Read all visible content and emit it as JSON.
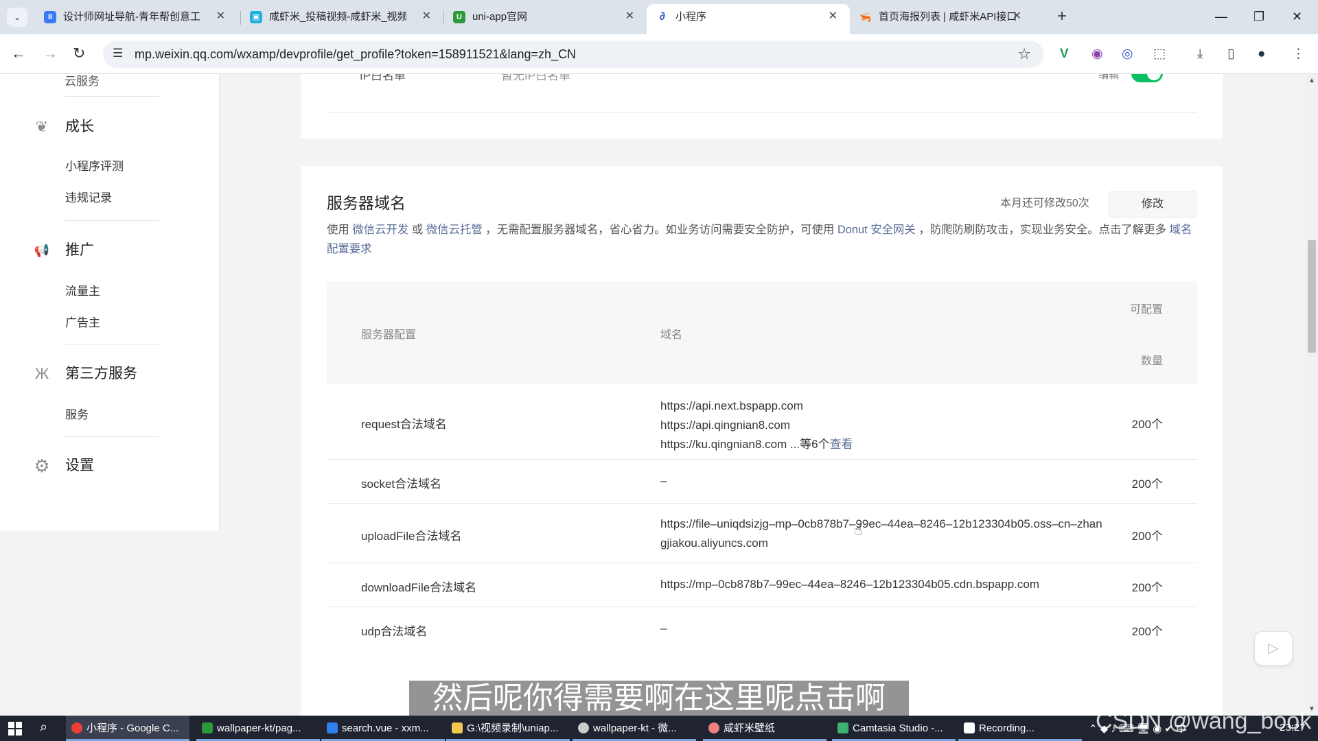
{
  "browser": {
    "tabs": [
      {
        "title": "设计师网址导航-青年帮创意工作",
        "fav_color": "#3b7bf6",
        "fav_glyph": "8"
      },
      {
        "title": "咸虾米_投稿视频-咸虾米_视频分享",
        "fav_color": "#23ade5",
        "fav_glyph": "▣"
      },
      {
        "title": "uni-app官网",
        "fav_color": "#2b9939",
        "fav_glyph": "U"
      },
      {
        "title": "小程序",
        "fav_color": "#ffffff",
        "fav_glyph": "∂"
      },
      {
        "title": "首页海报列表 | 咸虾米API接口开放",
        "fav_color": "#ffffff",
        "fav_glyph": "🦐"
      }
    ],
    "new_tab": "+",
    "url": "mp.weixin.qq.com/wxamp/devprofile/get_profile?token=158911521&lang=zh_CN"
  },
  "sidebar": {
    "cut_item": "云服务",
    "groups": [
      {
        "label": "成长",
        "icon": "leaf-icon",
        "glyph": "❦",
        "items": [
          "小程序评测",
          "违规记录"
        ]
      },
      {
        "label": "推广",
        "icon": "megaphone-icon",
        "glyph": "📢",
        "items": [
          "流量主",
          "广告主"
        ]
      },
      {
        "label": "第三方服务",
        "icon": "third-party-icon",
        "glyph": "Ж",
        "items": [
          "服务"
        ]
      },
      {
        "label": "设置",
        "icon": "gear-icon",
        "glyph": "⚙",
        "items": []
      }
    ]
  },
  "top_card": {
    "cut_label": "IP白名单",
    "cut_value": "暂无IP白名单",
    "cut_action": "编辑"
  },
  "server_domain": {
    "title": "服务器域名",
    "quota": "本月还可修改50次",
    "modify_button": "修改",
    "desc_1": "使用 ",
    "link_cloud_dev": "微信云开发",
    "desc_2": " 或 ",
    "link_cloud_host": "微信云托管",
    "desc_3": " ，无需配置服务器域名，省心省力。如业务访问需要安全防护，可使用 ",
    "link_donut": "Donut 安全网关",
    "desc_4": " ，防爬防刷防攻击，实现业务安全。点击了解更多 ",
    "link_requirements": "域名配置要求",
    "table": {
      "col_config": "服务器配置",
      "col_domain": "域名",
      "col_count_1": "可配置",
      "col_count_2": "数量",
      "rows": [
        {
          "name": "request合法域名",
          "domains": [
            "https://api.next.bspapp.com",
            "https://api.qingnian8.com",
            "https://ku.qingnian8.com ...等6个"
          ],
          "more": "查看",
          "count": "200个"
        },
        {
          "name": "socket合法域名",
          "domains": [
            "–"
          ],
          "count": "200个"
        },
        {
          "name": "uploadFile合法域名",
          "domains": [
            "https://file–uniqdsizjg–mp–0cb878b7–99ec–44ea–8246–12b123304b05.oss–cn–zhangjiakou.aliyuncs.com"
          ],
          "count": "200个"
        },
        {
          "name": "downloadFile合法域名",
          "domains": [
            "https://mp–0cb878b7–99ec–44ea–8246–12b123304b05.cdn.bspapp.com"
          ],
          "count": "200个"
        },
        {
          "name": "udp合法域名",
          "domains": [
            "–"
          ],
          "count": "200个"
        }
      ]
    }
  },
  "subtitle": "然后呢你得需要啊在这里呢点击啊",
  "taskbar": {
    "apps": [
      {
        "label": "小程序 - Google C...",
        "color": "#e94235"
      },
      {
        "label": "wallpaper-kt/pag...",
        "color": "#2b9939"
      },
      {
        "label": "search.vue - xxm...",
        "color": "#2f80ed"
      },
      {
        "label": "G:\\视频录制\\uniap...",
        "color": "#f2c94c"
      },
      {
        "label": "wallpaper-kt - 微...",
        "color": "#cccccc"
      },
      {
        "label": "咸虾米壁纸",
        "color": "#f08080"
      },
      {
        "label": "Camtasia Studio -...",
        "color": "#3cb371"
      },
      {
        "label": "Recording...",
        "color": "#ffffff"
      }
    ],
    "clock": "23:27"
  },
  "watermark": "CSDN @wang_book"
}
